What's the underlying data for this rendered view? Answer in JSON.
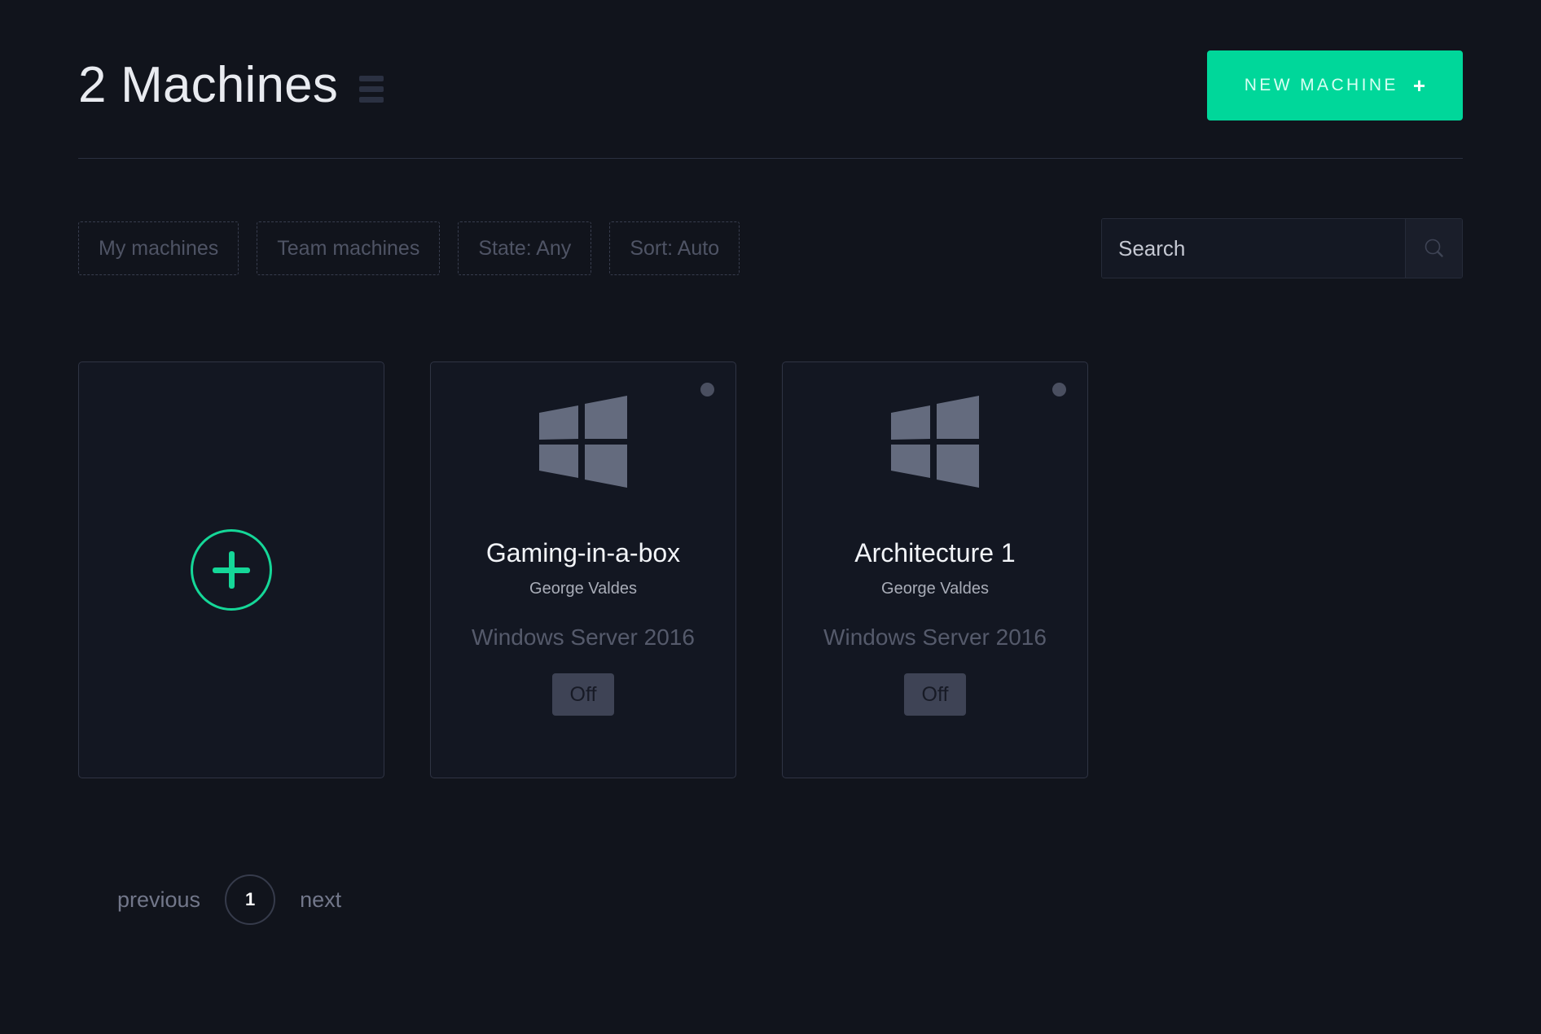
{
  "header": {
    "title": "2 Machines",
    "menu_icon": "hamburger-icon",
    "new_machine_label": "NEW MACHINE",
    "new_machine_plus": "+",
    "accent_color": "#00d79a"
  },
  "filters": {
    "chips": [
      {
        "label": "My machines"
      },
      {
        "label": "Team machines"
      },
      {
        "label": "State: Any"
      },
      {
        "label": "Sort: Auto"
      }
    ],
    "search": {
      "value": "",
      "placeholder": "Search",
      "icon": "search-icon"
    }
  },
  "cards": {
    "add_card": {
      "icon": "plus-circle-icon"
    },
    "machines": [
      {
        "name": "Gaming-in-a-box",
        "owner": "George Valdes",
        "os": "Windows Server 2016",
        "os_icon": "windows-logo-icon",
        "state": "Off",
        "status_color": "#4a4f60"
      },
      {
        "name": "Architecture 1",
        "owner": "George Valdes",
        "os": "Windows Server 2016",
        "os_icon": "windows-logo-icon",
        "state": "Off",
        "status_color": "#4a4f60"
      }
    ]
  },
  "pagination": {
    "previous": "previous",
    "current_page": "1",
    "next": "next"
  }
}
